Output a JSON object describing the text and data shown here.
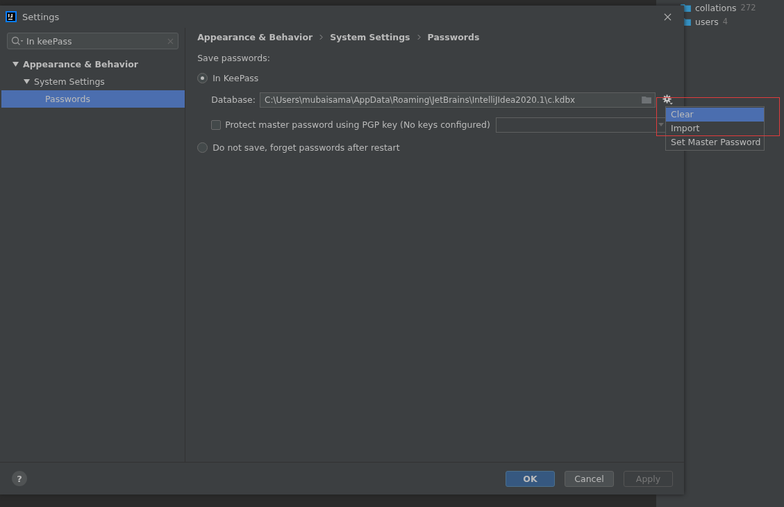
{
  "window": {
    "title": "Settings"
  },
  "search": {
    "value": "In keePass"
  },
  "tree": [
    {
      "label": "Appearance & Behavior",
      "expanded": true,
      "selected": false,
      "children": [
        {
          "label": "System Settings",
          "expanded": true,
          "selected": false,
          "children": [
            {
              "label": "Passwords",
              "selected": true
            }
          ]
        }
      ]
    }
  ],
  "breadcrumb": [
    "Appearance & Behavior",
    "System Settings",
    "Passwords"
  ],
  "section_label": "Save passwords:",
  "options": [
    {
      "label": "In KeePass",
      "selected": true
    },
    {
      "label": "Do not save, forget passwords after restart",
      "selected": false
    }
  ],
  "database": {
    "label": "Database:",
    "value": "C:\\Users\\mubaisama\\AppData\\Roaming\\JetBrains\\IntelliJIdea2020.1\\c.kdbx"
  },
  "pgp": {
    "label": "Protect master password using PGP key (No keys configured)",
    "checked": false
  },
  "gear_menu": [
    {
      "label": "Clear",
      "selected": true
    },
    {
      "label": "Import",
      "selected": false
    },
    {
      "label": "Set Master Password",
      "selected": false
    }
  ],
  "buttons": [
    {
      "label": "OK",
      "kind": "primary"
    },
    {
      "label": "Cancel",
      "kind": "normal"
    },
    {
      "label": "Apply",
      "kind": "disabled"
    }
  ],
  "help_button": "?",
  "background_tree": [
    {
      "label": "collations",
      "count": "272"
    },
    {
      "label": "users",
      "count": "4"
    }
  ]
}
